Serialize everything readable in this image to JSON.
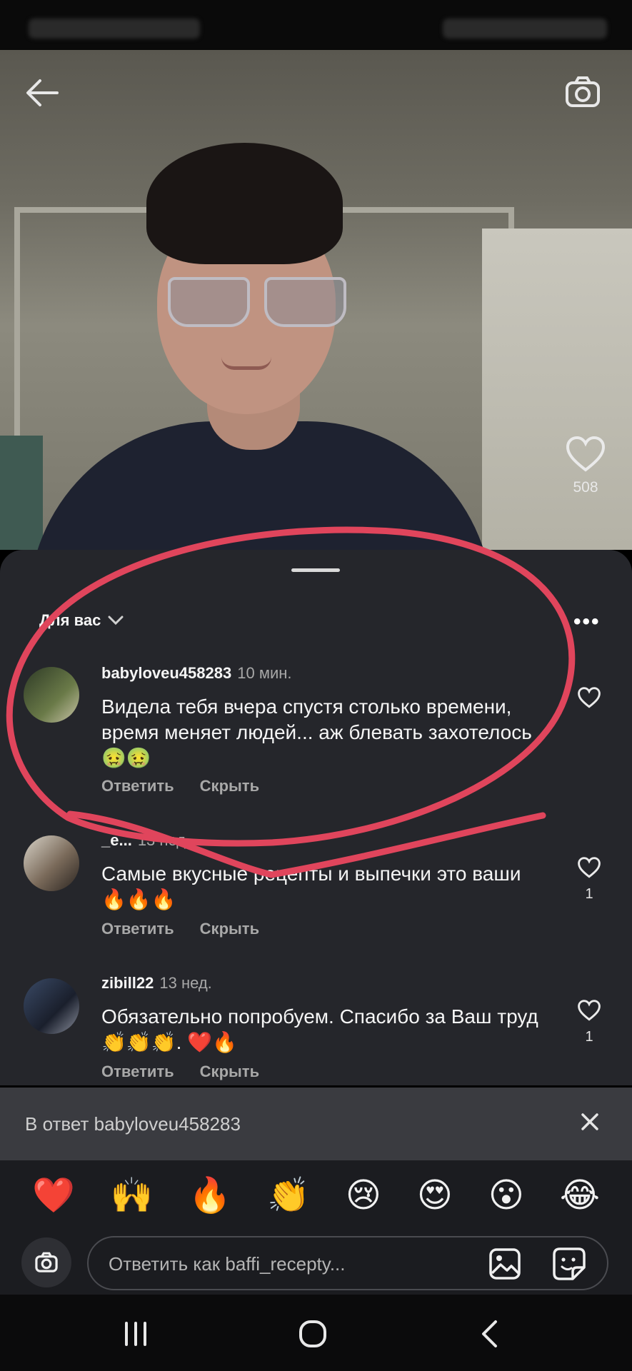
{
  "video": {
    "like_count": "508"
  },
  "comments_sheet": {
    "filter_label": "Для вас",
    "comments": [
      {
        "username": "babyloveu458283",
        "time": "10 мин.",
        "text": "Видела тебя вчера спустя столько времени, время меняет людей... аж блевать захотелось🤢🤢",
        "reply_label": "Ответить",
        "hide_label": "Скрыть",
        "likes": ""
      },
      {
        "username": "_e...",
        "time": "13 нед.",
        "text": "Самые вкусные рецепты и выпечки это ваши 🔥🔥🔥",
        "reply_label": "Ответить",
        "hide_label": "Скрыть",
        "likes": "1"
      },
      {
        "username": "zibill22",
        "time": "13 нед.",
        "text": "Обязательно попробуем.  Спасибо за Ваш труд 👏👏👏. ❤️🔥",
        "reply_label": "Ответить",
        "hide_label": "Скрыть",
        "likes": "1"
      }
    ]
  },
  "reply_bar": {
    "text": "В ответ babyloveu458283"
  },
  "emoji_bar": {
    "emojis": [
      "❤️",
      "🙌",
      "🔥",
      "👏",
      "😢",
      "😍",
      "😮",
      "😂"
    ]
  },
  "composer": {
    "placeholder": "Ответить как baffi_recepty..."
  },
  "colors": {
    "sheet_bg": "#25262b",
    "annotation_red": "#e0455c",
    "text_muted": "#a8a8a8"
  },
  "icons": [
    "back-arrow-icon",
    "camera-icon",
    "heart-icon",
    "chevron-down-icon",
    "more-icon",
    "close-icon",
    "gallery-icon",
    "sticker-icon",
    "recent-apps-icon",
    "home-icon",
    "back-icon"
  ]
}
